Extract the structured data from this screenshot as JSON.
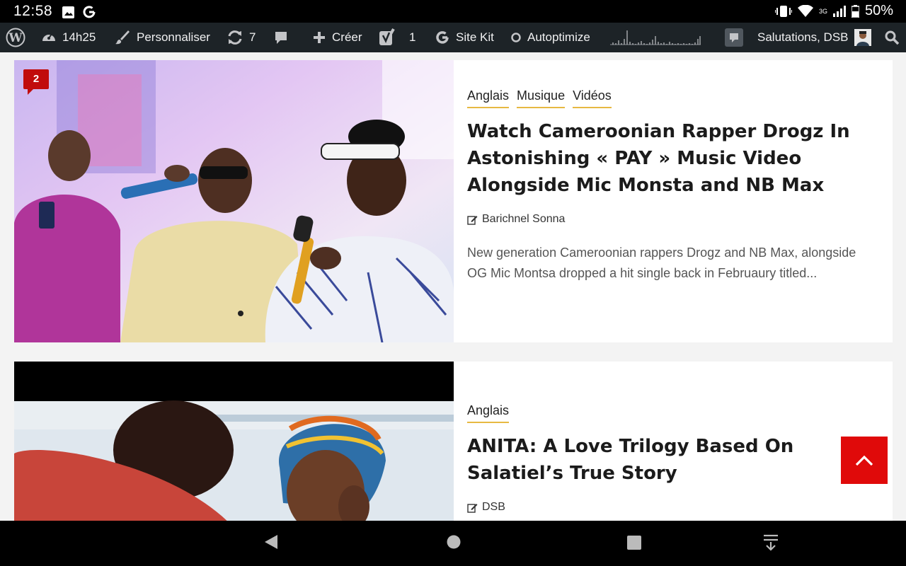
{
  "status": {
    "time": "12:58",
    "battery": "50%",
    "network": "3G"
  },
  "adminbar": {
    "time": "14h25",
    "customize": "Personnaliser",
    "updates_count": "7",
    "create": "Créer",
    "yoast_count": "1",
    "sitekit": "Site Kit",
    "autoptimize": "Autoptimize",
    "greeting": "Salutations, DSB"
  },
  "posts": [
    {
      "comments": "2",
      "categories": [
        "Anglais",
        "Musique",
        "Vidéos"
      ],
      "title": "Watch Cameroonian Rapper Drogz In Astonishing « PAY » Music Video Alongside Mic Monsta and NB Max",
      "author": "Barichnel Sonna",
      "excerpt": "New generation Cameroonian rappers Drogz and NB Max, alongside OG Mic Montsa dropped a hit single back in Februaury titled..."
    },
    {
      "categories": [
        "Anglais"
      ],
      "title": "ANITA: A Love Trilogy Based On Salatiel’s True Story",
      "author": "DSB"
    }
  ],
  "icons": {
    "wordpress": "wordpress-icon",
    "dashboard": "gauge-icon",
    "customize": "brush-icon",
    "updates": "refresh-icon",
    "comments": "comment-icon",
    "create": "plus-icon",
    "yoast": "yoast-icon",
    "sitekit": "google-g-icon",
    "autoptimize": "circle-icon",
    "search": "search-icon"
  },
  "colors": {
    "adminbar_bg": "#1d2327",
    "category_underline": "#e7b942",
    "badge": "#c10c0c",
    "scrolltop": "#e00a0a"
  }
}
